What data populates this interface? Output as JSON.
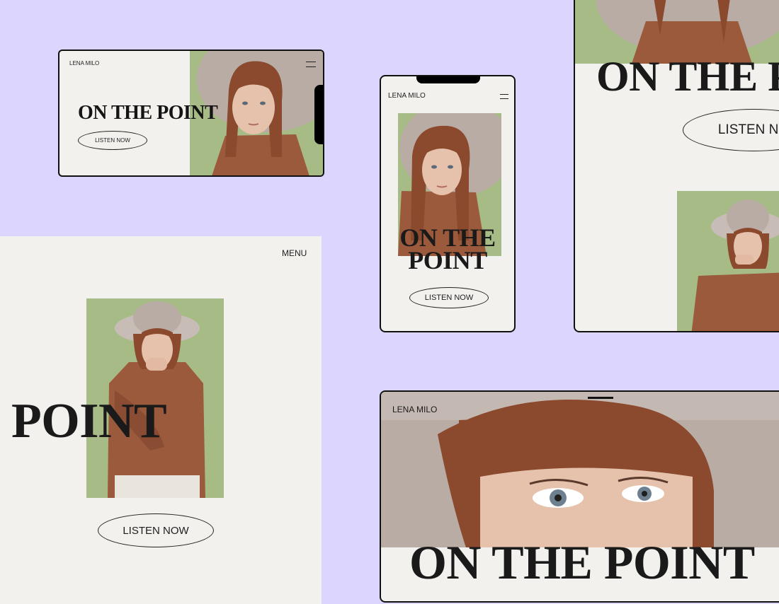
{
  "colors": {
    "background": "#dcd6ff",
    "page": "#f3f1ee",
    "ink": "#1e1e1e",
    "photo_bg": "#a7bb86",
    "sweater": "#9b5a3c",
    "hat": "#b9aca4",
    "hair": "#8b4a2e"
  },
  "landscape_mobile": {
    "brand": "LENA MILO",
    "headline": "ON THE POINT",
    "cta": "LISTEN NOW",
    "menu_icon": "hamburger-icon"
  },
  "portrait_mobile": {
    "brand": "LENA MILO",
    "headline_line1": "ON THE",
    "headline_line2": "POINT",
    "cta": "LISTEN NOW",
    "menu_icon": "hamburger-icon"
  },
  "tablet_right": {
    "headline": "ON THE P",
    "cta": "LISTEN NO"
  },
  "desktop_left": {
    "menu": "MENU",
    "headline": "POINT",
    "cta": "LISTEN NOW"
  },
  "desktop_bottom": {
    "brand": "LENA MILO",
    "headline": "ON THE POINT"
  }
}
